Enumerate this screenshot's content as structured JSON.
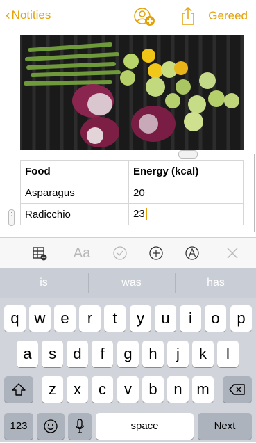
{
  "nav": {
    "back_label": "Notities",
    "done_label": "Gereed"
  },
  "table": {
    "headers": [
      "Food",
      "Energy (kcal)"
    ],
    "rows": [
      [
        "Asparagus",
        "20"
      ],
      [
        "Radicchio",
        "23"
      ]
    ]
  },
  "format_toolbar": {
    "icons": [
      "table-icon",
      "text-format-icon",
      "checklist-icon",
      "add-icon",
      "markup-icon",
      "close-icon"
    ],
    "aa_label": "Aa"
  },
  "suggestions": [
    "is",
    "was",
    "has"
  ],
  "keyboard": {
    "row1": [
      "q",
      "w",
      "e",
      "r",
      "t",
      "y",
      "u",
      "i",
      "o",
      "p"
    ],
    "row2": [
      "a",
      "s",
      "d",
      "f",
      "g",
      "h",
      "j",
      "k",
      "l"
    ],
    "row3": [
      "z",
      "x",
      "c",
      "v",
      "b",
      "n",
      "m"
    ],
    "numbers_label": "123",
    "space_label": "space",
    "next_label": "Next"
  },
  "colors": {
    "accent": "#e3a20a",
    "keyboard_bg": "#d1d5db",
    "suggestion_bg": "#c9ced6"
  }
}
